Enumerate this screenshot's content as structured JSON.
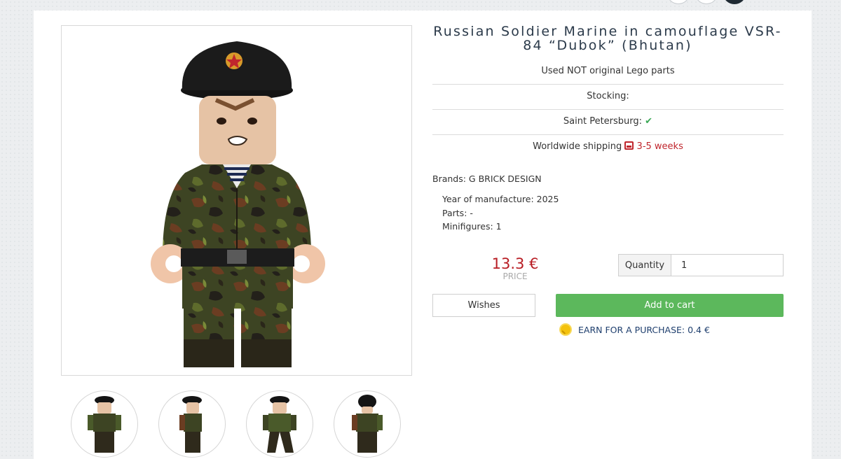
{
  "product": {
    "title": "Russian Soldier Marine in camouflage VSR-84 “Dubok” (Bhutan)",
    "note": "Used NOT original Lego parts",
    "stocking_label": "Stocking:",
    "location_label": "Saint Petersburg:",
    "location_status_icon": "check-icon",
    "shipping_label": "Worldwide shipping",
    "shipping_time": "3-5 weeks",
    "brand": "Brands: G BRICK DESIGN",
    "year": "Year of manufacture: 2025",
    "parts": "Parts: -",
    "minifigures": "Minifigures: 1",
    "price": "13.3 €",
    "price_label": "PRICE",
    "quantity_label": "Quantity",
    "quantity_value": "1",
    "wishes_label": "Wishes",
    "add_to_cart_label": "Add to cart",
    "earn_label": "EARN FOR A PURCHASE: 0.4 €"
  },
  "colors": {
    "accent_green": "#5cb85c",
    "price_red": "#b81d24",
    "title_navy": "#2b3a4a",
    "camo_dark": "#2f2a1c",
    "camo_green": "#4a5a2a",
    "camo_brown": "#6b3d22"
  },
  "gallery": {
    "thumbnails": [
      "front-view",
      "side-view",
      "walking-view",
      "back-view"
    ]
  }
}
